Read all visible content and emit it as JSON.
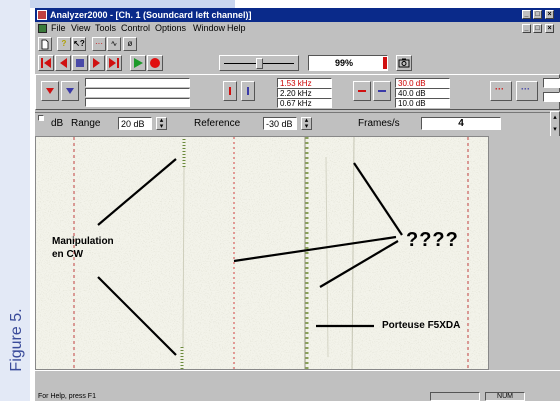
{
  "figure_label": "Figure 5.",
  "window": {
    "title": "Analyzer2000 - [Ch. 1 (Soundcard left channel)]",
    "menu": [
      "File",
      "View",
      "Tools",
      "Control",
      "Options",
      "Window",
      "Help"
    ]
  },
  "toolbar": {
    "percent": "99%"
  },
  "frequency": {
    "f1": "1.53 kHz",
    "f2": "2.20 kHz",
    "f3": "0.67 kHz"
  },
  "level": {
    "l1": "30.0 dB",
    "l2": "40.0 dB",
    "l3": "10.0 dB"
  },
  "settings": {
    "db_label": "dB",
    "range_label": "Range",
    "range_value": "20 dB",
    "reference_label": "Reference",
    "reference_value": "-30 dB",
    "frames_label": "Frames/s",
    "frames_value": "4"
  },
  "annotations": {
    "manipulation": "Manipulation\nen CW",
    "question": "????",
    "carrier": "Porteuse F5XDA"
  },
  "status": {
    "help": "For Help, press F1",
    "num": "NUM"
  },
  "colors": {
    "title_bar": "#0a2a8a",
    "accent_red": "#d01010",
    "accent_green": "#1c9a2a",
    "figure_label": "#3a4b9a"
  }
}
